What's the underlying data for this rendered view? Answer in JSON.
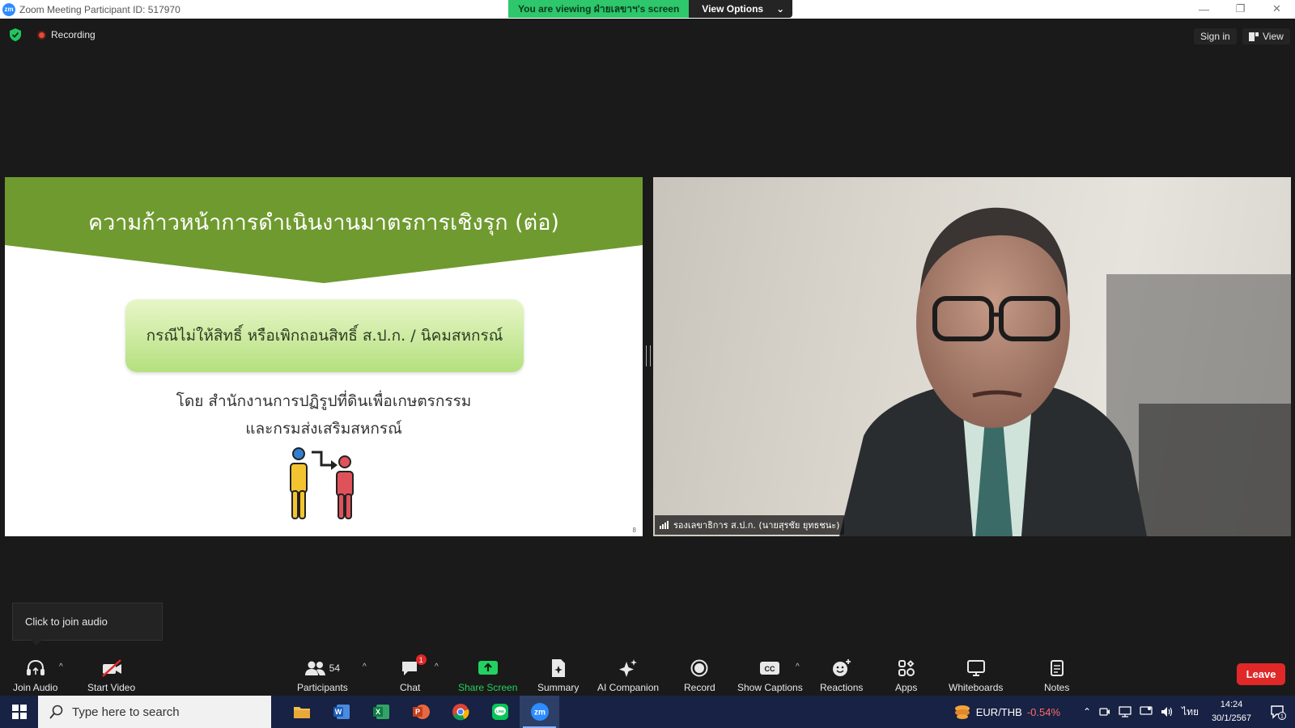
{
  "window": {
    "title": "Zoom Meeting Participant ID: 517970",
    "viewing_banner": "You are viewing ฝ่ายเลขาฯ's screen",
    "view_options": "View Options"
  },
  "topbar": {
    "recording": "Recording",
    "sign_in": "Sign in",
    "view": "View"
  },
  "slide": {
    "title": "ความก้าวหน้าการดำเนินงานมาตรการเชิงรุก (ต่อ)",
    "box_text": "กรณีไม่ให้สิทธิ์ หรือเพิกถอนสิทธิ์ ส.ป.ก. / นิคมสหกรณ์",
    "line1": "โดย สำนักงานการปฏิรูปที่ดินเพื่อเกษตรกรรม",
    "line2": "และกรมส่งเสริมสหกรณ์",
    "page_number": "8",
    "title_bg": "#6f9a2f"
  },
  "video": {
    "participant_name": "รองเลขาธิการ ส.ป.ก. (นายสุรชัย ยุทธชนะ)"
  },
  "tooltip": {
    "text": "Click to join audio"
  },
  "toolbar": {
    "join_audio": "Join Audio",
    "start_video": "Start Video",
    "participants": "Participants",
    "participants_count": "54",
    "chat": "Chat",
    "chat_badge": "1",
    "share_screen": "Share Screen",
    "summary": "Summary",
    "ai_companion": "AI Companion",
    "record": "Record",
    "show_captions": "Show Captions",
    "reactions": "Reactions",
    "apps": "Apps",
    "whiteboards": "Whiteboards",
    "notes": "Notes",
    "leave": "Leave",
    "share_color": "#23d160",
    "leave_color": "#e02828"
  },
  "taskbar": {
    "search_placeholder": "Type here to search",
    "fx_pair": "EUR/THB",
    "fx_change": "-0.54%",
    "language": "ไทย",
    "time": "14:24",
    "date": "30/1/2567",
    "notif_count": "1"
  }
}
